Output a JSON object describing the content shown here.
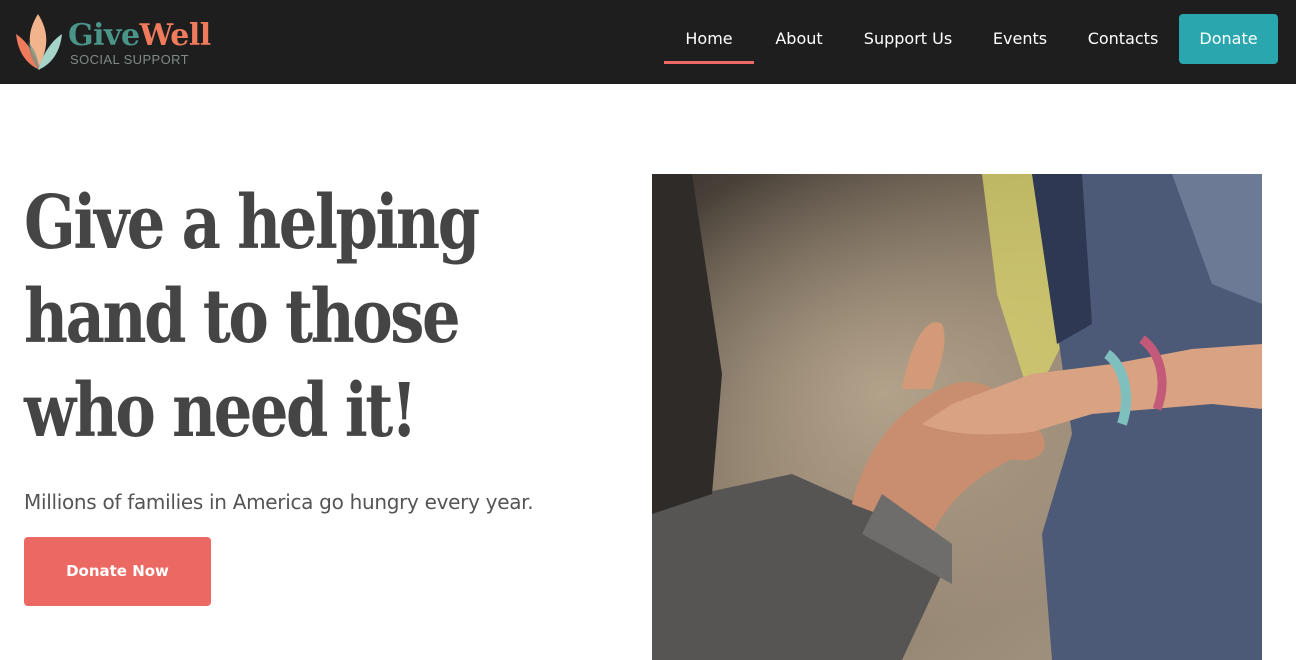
{
  "brand": {
    "name_part1": "Give",
    "name_part2": "Well",
    "tagline": "SOCIAL SUPPORT",
    "colors": {
      "teal": "#4a9488",
      "coral": "#ef7a5c",
      "peach": "#f2b48c",
      "mint": "#a6d4c8"
    }
  },
  "nav": {
    "items": [
      {
        "label": "Home",
        "active": true
      },
      {
        "label": "About",
        "active": false
      },
      {
        "label": "Support Us",
        "active": false
      },
      {
        "label": "Events",
        "active": false
      },
      {
        "label": "Contacts",
        "active": false
      }
    ],
    "donate_label": "Donate"
  },
  "hero": {
    "title": "Give a helping hand to those who need it!",
    "subtitle": "Millions of families in America go hungry every year.",
    "cta_label": "Donate Now",
    "image": "photo of two people clasping hands"
  },
  "colors": {
    "header_bg": "#1e1e1e",
    "accent_teal": "#2aa7ae",
    "accent_coral": "#ec6963",
    "text_dark": "#454545"
  }
}
